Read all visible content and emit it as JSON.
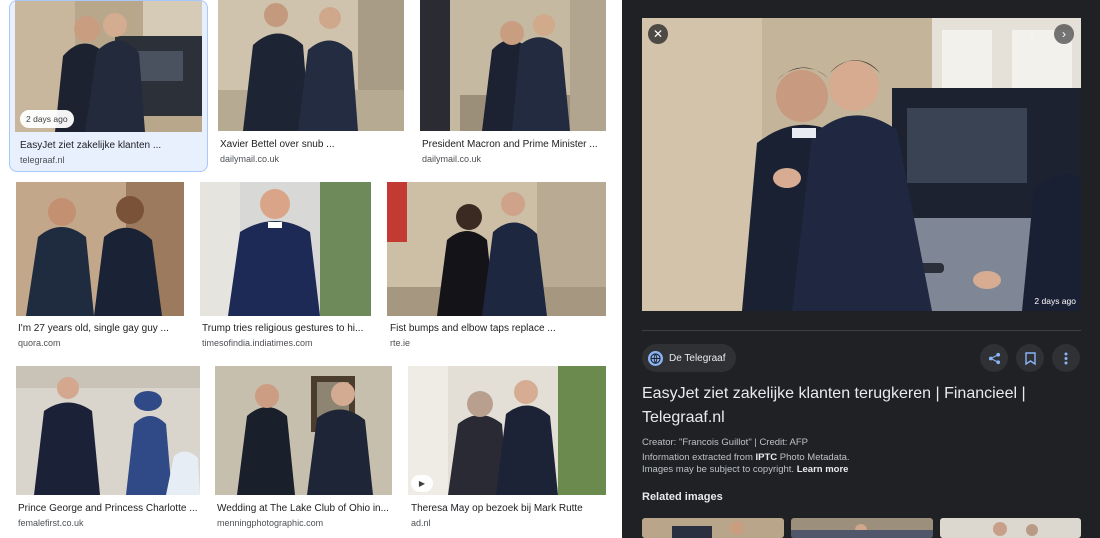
{
  "results": [
    {
      "badge": "2 days ago",
      "title": "EasyJet ziet zakelijke klanten ...",
      "source": "telegraaf.nl"
    },
    {
      "title": "Xavier Bettel over snub ...",
      "source": "dailymail.co.uk"
    },
    {
      "title": "President Macron and Prime Minister ...",
      "source": "dailymail.co.uk"
    },
    {
      "title": "I'm 27 years old, single gay guy ...",
      "source": "quora.com"
    },
    {
      "title": "Trump tries religious gestures to hi...",
      "source": "timesofindia.indiatimes.com"
    },
    {
      "title": "Fist bumps and elbow taps replace ...",
      "source": "rte.ie"
    },
    {
      "title": "Prince George and Princess Charlotte ...",
      "source": "femalefirst.co.uk"
    },
    {
      "title": "Wedding at The Lake Club of Ohio in...",
      "source": "menningphotographic.com"
    },
    {
      "title": "Theresa May op bezoek bij Mark Rutte",
      "source": "ad.nl"
    }
  ],
  "icons": {
    "close": "close-icon",
    "prev": "chevron-left-icon",
    "next": "chevron-right-icon",
    "share": "share-icon",
    "save": "bookmark-icon",
    "more": "more-vert-icon",
    "source": "globe-icon",
    "video": "play-icon"
  },
  "detail": {
    "badge": "2 days ago",
    "source_name": "De Telegraaf",
    "title": "EasyJet ziet zakelijke klanten terugkeren | Financieel | Telegraaf.nl",
    "creator": "Creator: \"Francois Guillot\" | Credit: AFP",
    "info_prefix": "Information extracted from ",
    "info_bold": "IPTC",
    "info_suffix": " Photo Metadata.",
    "copyright": "Images may be subject to copyright. ",
    "learn_more": "Learn more",
    "related_heading": "Related images"
  },
  "colors": {
    "panel_bg": "#202124",
    "selected_bg": "#e8f0fe",
    "accent": "#8ab4f8"
  }
}
